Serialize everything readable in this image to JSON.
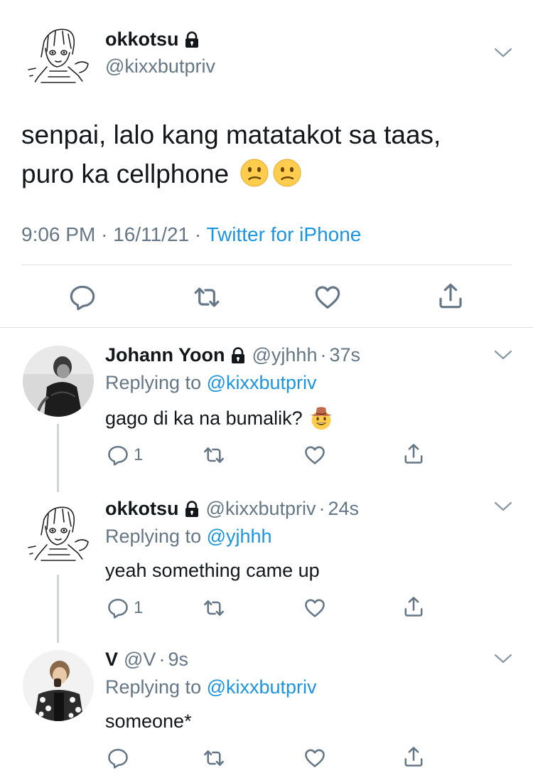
{
  "main_tweet": {
    "display_name": "okkotsu",
    "handle": "@kixxbutpriv",
    "text_line1": "senpai, lalo kang matatakot sa taas,",
    "text_line2": "puro ka cellphone",
    "emojis": [
      "confused-face",
      "confused-face"
    ],
    "time": "9:06 PM",
    "sep1": "·",
    "date": "16/11/21",
    "sep2": "·",
    "source": "Twitter for iPhone",
    "protected": true,
    "actions": [
      "reply-icon",
      "retweet-icon",
      "like-icon",
      "share-icon"
    ]
  },
  "replies": [
    {
      "display_name": "Johann Yoon",
      "handle": "@yjhhh",
      "dot": "·",
      "time": "37s",
      "protected": true,
      "replying_prefix": "Replying to ",
      "replying_to": "@kixxbutpriv",
      "text": "gago di ka na bumalik?",
      "emoji": "cowboy-hat-face",
      "reply_count": "1"
    },
    {
      "display_name": "okkotsu",
      "handle": "@kixxbutpriv",
      "dot": "·",
      "time": "24s",
      "protected": true,
      "replying_prefix": "Replying to ",
      "replying_to": "@yjhhh",
      "text": "yeah something came up",
      "reply_count": "1"
    },
    {
      "display_name": "V",
      "handle": "@V",
      "dot": "·",
      "time": "9s",
      "protected": false,
      "replying_prefix": "Replying to ",
      "replying_to": "@kixxbutpriv",
      "text": "someone*",
      "reply_count": ""
    }
  ],
  "colors": {
    "text": "#14171a",
    "secondary": "#657786",
    "link": "#1b95e0",
    "divider": "#dfe3e6",
    "thread_line": "#cdd5db"
  }
}
